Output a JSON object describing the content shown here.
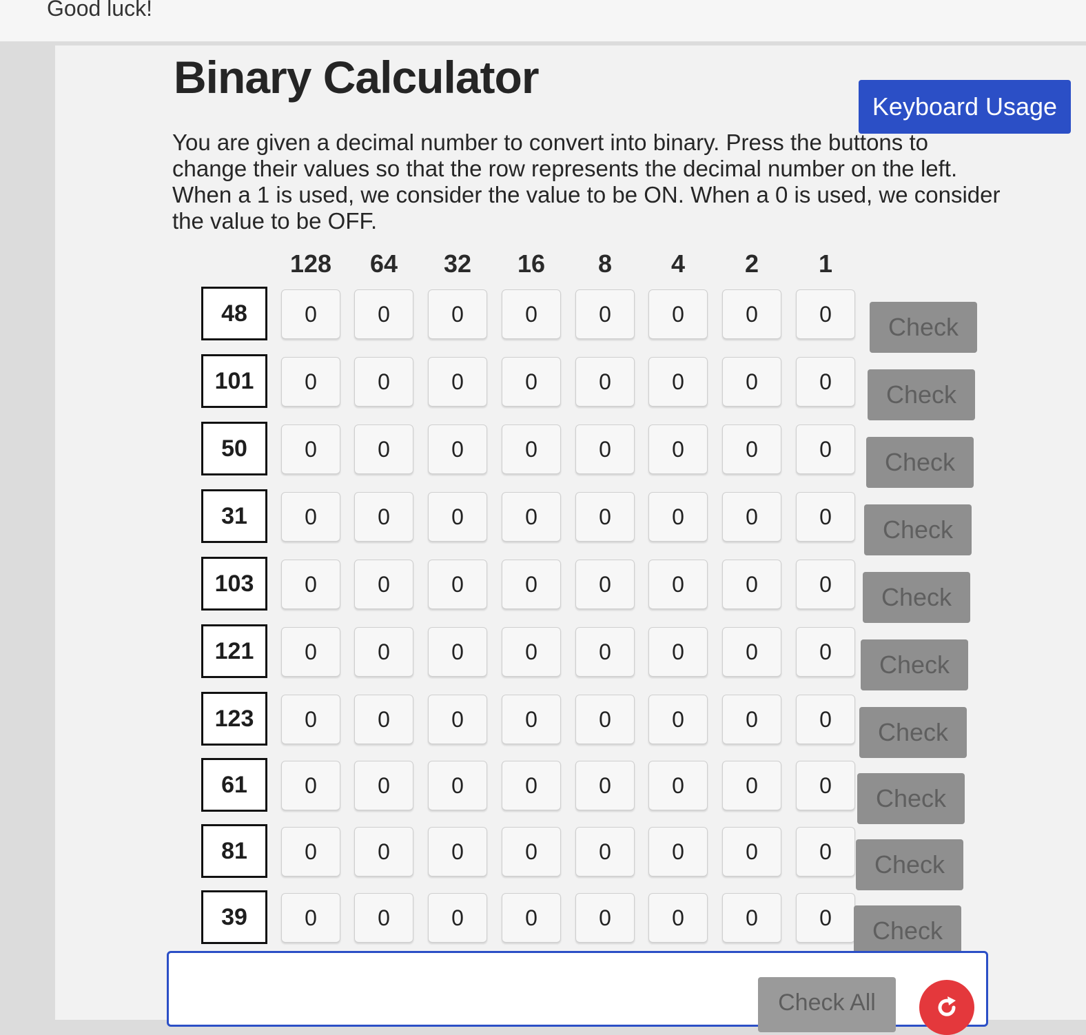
{
  "header": {
    "good_luck": "Good luck!"
  },
  "title": "Binary Calculator",
  "keyboard_usage_label": "Keyboard Usage",
  "description": "You are given a decimal number to convert into binary. Press the buttons to change their values so that the row represents the decimal number on the left. When a 1 is used, we consider the value to be ON. When a 0 is used, we consider the value to be OFF.",
  "columns": [
    "128",
    "64",
    "32",
    "16",
    "8",
    "4",
    "2",
    "1"
  ],
  "rows": [
    {
      "decimal": "48",
      "bits": [
        "0",
        "0",
        "0",
        "0",
        "0",
        "0",
        "0",
        "0"
      ],
      "check_label": "Check"
    },
    {
      "decimal": "101",
      "bits": [
        "0",
        "0",
        "0",
        "0",
        "0",
        "0",
        "0",
        "0"
      ],
      "check_label": "Check"
    },
    {
      "decimal": "50",
      "bits": [
        "0",
        "0",
        "0",
        "0",
        "0",
        "0",
        "0",
        "0"
      ],
      "check_label": "Check"
    },
    {
      "decimal": "31",
      "bits": [
        "0",
        "0",
        "0",
        "0",
        "0",
        "0",
        "0",
        "0"
      ],
      "check_label": "Check"
    },
    {
      "decimal": "103",
      "bits": [
        "0",
        "0",
        "0",
        "0",
        "0",
        "0",
        "0",
        "0"
      ],
      "check_label": "Check"
    },
    {
      "decimal": "121",
      "bits": [
        "0",
        "0",
        "0",
        "0",
        "0",
        "0",
        "0",
        "0"
      ],
      "check_label": "Check"
    },
    {
      "decimal": "123",
      "bits": [
        "0",
        "0",
        "0",
        "0",
        "0",
        "0",
        "0",
        "0"
      ],
      "check_label": "Check"
    },
    {
      "decimal": "61",
      "bits": [
        "0",
        "0",
        "0",
        "0",
        "0",
        "0",
        "0",
        "0"
      ],
      "check_label": "Check"
    },
    {
      "decimal": "81",
      "bits": [
        "0",
        "0",
        "0",
        "0",
        "0",
        "0",
        "0",
        "0"
      ],
      "check_label": "Check"
    },
    {
      "decimal": "39",
      "bits": [
        "0",
        "0",
        "0",
        "0",
        "0",
        "0",
        "0",
        "0"
      ],
      "check_label": "Check"
    }
  ],
  "footer": {
    "check_all_label": "Check All",
    "reset_icon": "refresh-icon"
  },
  "colors": {
    "primary": "#2b4fc6",
    "check_disabled": "#8f8f8f",
    "reset": "#e4383c"
  }
}
